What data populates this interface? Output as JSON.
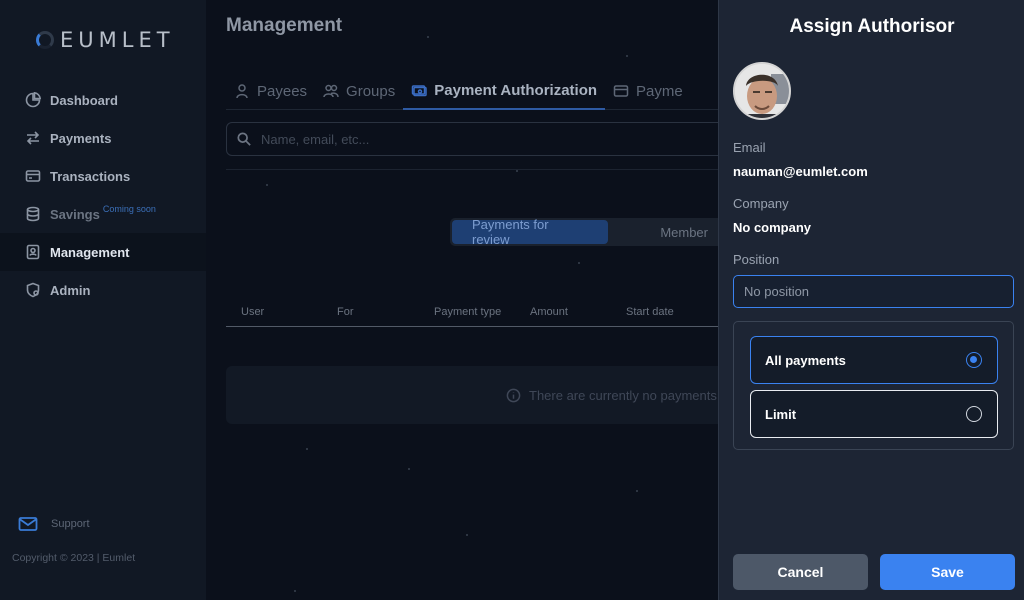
{
  "app": {
    "logo_text": "EUMLET"
  },
  "sidebar": {
    "items": [
      {
        "label": "Dashboard",
        "icon": "pie-chart-icon"
      },
      {
        "label": "Payments",
        "icon": "arrows-exchange-icon"
      },
      {
        "label": "Transactions",
        "icon": "card-icon"
      },
      {
        "label": "Savings",
        "icon": "database-icon",
        "badge": "Coming soon"
      },
      {
        "label": "Management",
        "icon": "id-badge-icon",
        "active": true
      },
      {
        "label": "Admin",
        "icon": "shield-gear-icon"
      }
    ],
    "support_label": "Support",
    "copyright": "Copyright © 2023 | Eumlet"
  },
  "main": {
    "title": "Management",
    "tabs": [
      {
        "label": "Payees",
        "icon": "person-icon"
      },
      {
        "label": "Groups",
        "icon": "people-icon"
      },
      {
        "label": "Payment Authorization",
        "icon": "money-icon",
        "active": true
      },
      {
        "label": "Payme",
        "icon": "card-icon"
      }
    ],
    "search_placeholder": "Name, email, etc...",
    "segments": [
      {
        "label": "Payments for review",
        "active": true
      },
      {
        "label": "Member"
      }
    ],
    "table_headers": [
      "User",
      "For",
      "Payment type",
      "Amount",
      "Start date"
    ],
    "empty_message": "There are currently no payments"
  },
  "drawer": {
    "title": "Assign Authorisor",
    "email_label": "Email",
    "email_value": "nauman@eumlet.com",
    "company_label": "Company",
    "company_value": "No company",
    "position_label": "Position",
    "position_placeholder": "No position",
    "options": [
      {
        "label": "All payments",
        "selected": true
      },
      {
        "label": "Limit",
        "selected": false
      }
    ],
    "cancel_label": "Cancel",
    "save_label": "Save"
  },
  "colors": {
    "accent": "#3a82f0",
    "background": "#0b101b",
    "drawer": "#1d2534"
  }
}
